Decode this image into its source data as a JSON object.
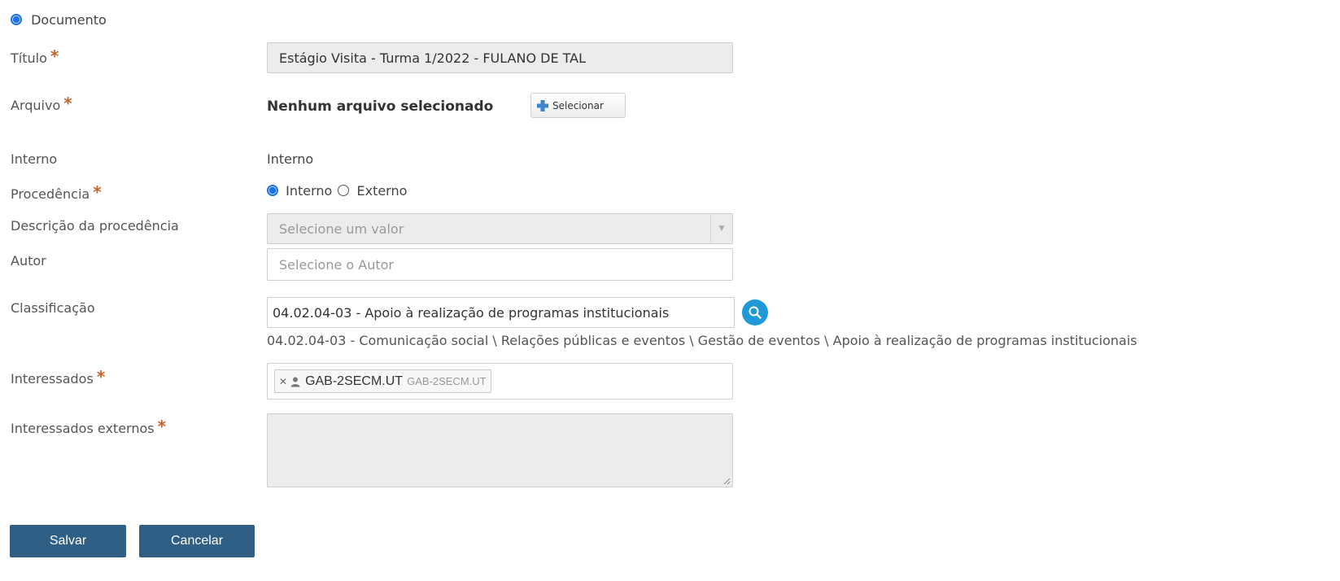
{
  "type_option": {
    "label": "Documento"
  },
  "titulo": {
    "label": "Título",
    "value": "Estágio Visita - Turma 1/2022 - FULANO DE TAL"
  },
  "arquivo": {
    "label": "Arquivo",
    "status": "Nenhum arquivo selecionado",
    "button_label": "Selecionar"
  },
  "interno": {
    "label": "Interno",
    "value": "Interno"
  },
  "procedencia": {
    "label": "Procedência",
    "option_interno": "Interno",
    "option_externo": "Externo",
    "selected": "Interno"
  },
  "descricao_procedencia": {
    "label": "Descrição da procedência",
    "placeholder": "Selecione um valor"
  },
  "autor": {
    "label": "Autor",
    "placeholder": "Selecione o Autor"
  },
  "classificacao": {
    "label": "Classificação",
    "value": "04.02.04-03 - Apoio à realização de programas institucionais",
    "path": "04.02.04-03 - Comunicação social \\ Relações públicas e eventos \\ Gestão de eventos \\ Apoio à realização de programas institucionais"
  },
  "interessados": {
    "label": "Interessados",
    "tag_name": "GAB-2SECM.UT",
    "tag_sub": "GAB-2SECM.UT"
  },
  "interessados_externos": {
    "label": "Interessados externos",
    "value": ""
  },
  "actions": {
    "save_label": "Salvar",
    "cancel_label": "Cancelar"
  },
  "colors": {
    "primary_button": "#2f5f85",
    "required_star": "#c8622a",
    "radio_selected": "#1a73e8",
    "search_button": "#1e9ad6"
  },
  "icons": {
    "add": "plus-icon",
    "search": "search-icon",
    "remove": "close-icon",
    "person": "user-icon"
  }
}
